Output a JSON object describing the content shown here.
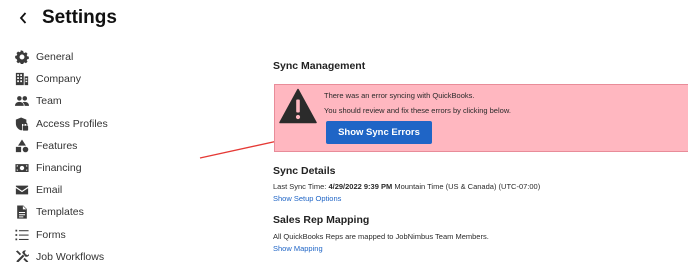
{
  "header": {
    "title": "Settings"
  },
  "sidebar": {
    "items": [
      {
        "label": "General",
        "icon": "gear-icon"
      },
      {
        "label": "Company",
        "icon": "building-icon"
      },
      {
        "label": "Team",
        "icon": "team-icon"
      },
      {
        "label": "Access Profiles",
        "icon": "shield-lock-icon"
      },
      {
        "label": "Features",
        "icon": "shapes-icon"
      },
      {
        "label": "Financing",
        "icon": "money-icon"
      },
      {
        "label": "Email",
        "icon": "envelope-icon"
      },
      {
        "label": "Templates",
        "icon": "document-icon"
      },
      {
        "label": "Forms",
        "icon": "list-icon"
      },
      {
        "label": "Job Workflows",
        "icon": "tools-icon"
      }
    ]
  },
  "sync": {
    "heading": "Sync Management",
    "error_line1": "There was an error syncing with QuickBooks.",
    "error_line2": "You should review and fix these errors by clicking below.",
    "button_label": "Show Sync Errors"
  },
  "details": {
    "heading": "Sync Details",
    "last_sync_prefix": "Last Sync Time: ",
    "last_sync_value": "4/29/2022 9:39 PM",
    "last_sync_suffix": " Mountain Time (US & Canada) (UTC-07:00)",
    "setup_link": "Show Setup Options"
  },
  "rep_mapping": {
    "heading": "Sales Rep Mapping",
    "text": "All QuickBooks Reps are mapped to JobNimbus Team Members.",
    "link": "Show Mapping"
  },
  "colors": {
    "banner_bg": "#ffb7c0",
    "button": "#1f65c6",
    "annotation_arrow": "#e53935"
  }
}
